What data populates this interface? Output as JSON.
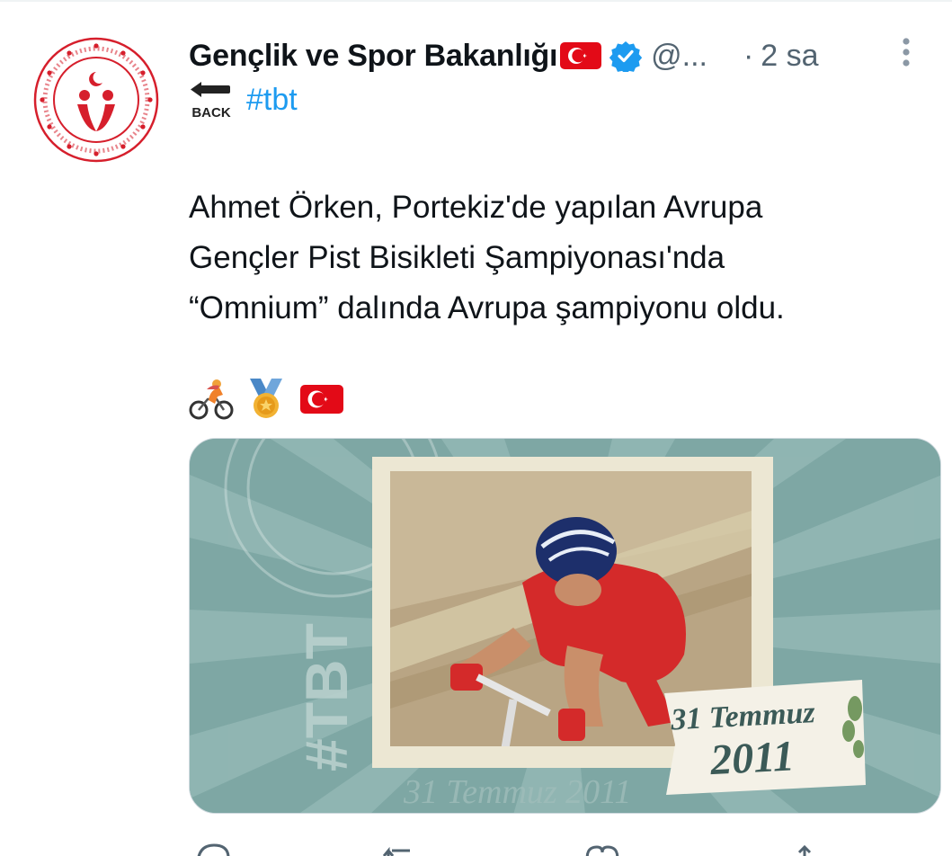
{
  "tweet": {
    "display_name": "Gençlik ve Spor Bakanlığı",
    "handle": "@...",
    "dot": "·",
    "timestamp": "2 sa",
    "back_label": "BACK",
    "hashtag": "#tbt",
    "text": "Ahmet Örken, Portekiz'de yapılan Avrupa\nGençler Pist Bisikleti Şampiyonası'nda\n“Omnium” dalında Avrupa şampiyonu oldu.",
    "emojis": [
      "person-biking-icon",
      "medal-icon",
      "turkey-flag-icon"
    ]
  },
  "media": {
    "tbt_label": "#TBT",
    "date_line1": "31 Temmuz",
    "date_line2": "2011",
    "bg_date": "31 Temmuz 2011"
  },
  "colors": {
    "link": "#1d9bf0",
    "secondary": "#536471",
    "verified": "#1d9bf0",
    "teal": "#7ea7a4",
    "flag_red": "#e30a17"
  }
}
